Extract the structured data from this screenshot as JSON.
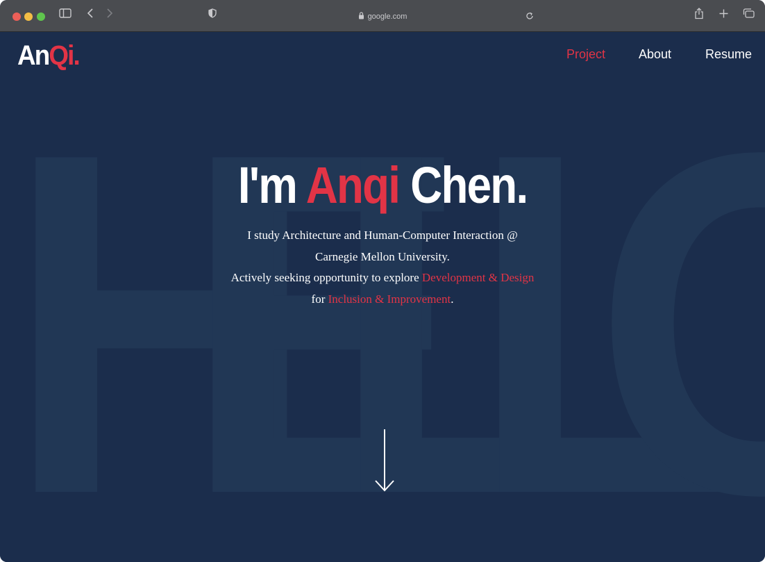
{
  "browser": {
    "url": "google.com",
    "icons": [
      "sidebar-icon",
      "back-icon",
      "forward-icon",
      "shield-icon",
      "lock-icon",
      "reload-icon",
      "share-icon",
      "new-tab-icon",
      "tabs-overview-icon"
    ]
  },
  "site": {
    "logo": {
      "part1": "An",
      "part2": "Qi",
      "part3": "."
    },
    "nav": [
      {
        "label": "Project",
        "active": true
      },
      {
        "label": "About",
        "active": false
      },
      {
        "label": "Resume",
        "active": false
      }
    ],
    "background_text": [
      "H",
      "E",
      "L",
      "L",
      "O"
    ],
    "hero": {
      "prefix": "I'm ",
      "highlight": "Anqi",
      "suffix": " Chen."
    },
    "description": {
      "line1": "I study Architecture and Human-Computer Interaction @",
      "line2": "Carnegie Mellon University.",
      "line3_prefix": "Actively seeking opportunity to explore ",
      "line3_highlight": "Development & Design",
      "line4_prefix": "for ",
      "line4_highlight": "Inclusion & Improvement",
      "line4_suffix": "."
    },
    "colors": {
      "background": "#1b2d4c",
      "accent": "#e23446",
      "text": "#ffffff",
      "bg_letters": "#213755"
    },
    "scroll_icon": "arrow-down-icon"
  }
}
